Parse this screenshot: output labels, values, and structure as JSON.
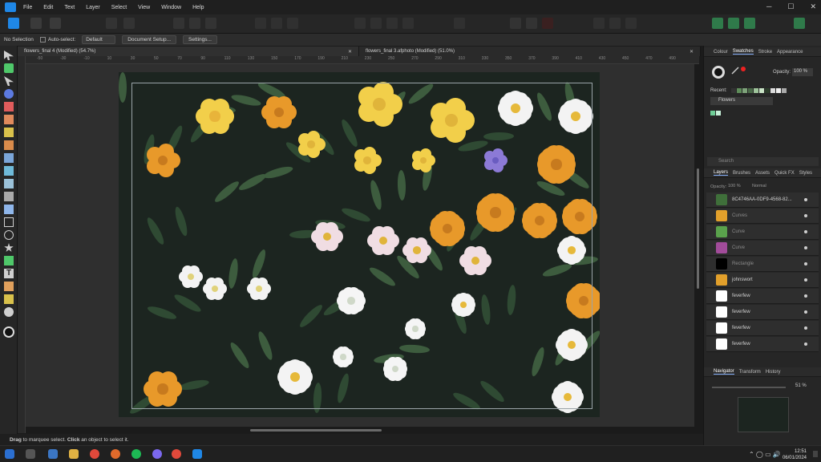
{
  "menu": [
    "File",
    "Edit",
    "Text",
    "Layer",
    "Select",
    "View",
    "Window",
    "Help"
  ],
  "context": {
    "selection": "No Selection",
    "autoselect_label": "Auto-select:",
    "autoselect_value": "Default",
    "document_setup": "Document Setup...",
    "settings": "Settings..."
  },
  "tabs": [
    {
      "label": "flowers_final 4 (Modified) (54.7%)"
    },
    {
      "label": "flowers_final 3.afphoto (Modified) (51.0%)"
    }
  ],
  "ruler_labels": [
    "-50",
    "-40",
    "-30",
    "-20",
    "-10",
    "0",
    "10",
    "20",
    "30",
    "40",
    "50",
    "60",
    "70",
    "80",
    "90",
    "100",
    "110",
    "120",
    "130",
    "140",
    "150",
    "160",
    "170",
    "180",
    "190",
    "200",
    "210",
    "220",
    "230",
    "240",
    "250",
    "260",
    "270",
    "280",
    "290",
    "300",
    "310",
    "320",
    "330",
    "340",
    "350",
    "360",
    "370",
    "380",
    "390",
    "400",
    "410",
    "420",
    "430",
    "440",
    "450",
    "460",
    "470",
    "480",
    "490",
    "500"
  ],
  "right_panel": {
    "top_tabs": [
      "Colour",
      "Swatches",
      "Stroke",
      "Appearance"
    ],
    "opacity_label": "Opacity:",
    "opacity_value": "100 %",
    "recent_label": "Recent:",
    "palette_name": "Flowers",
    "search_placeholder": "Search",
    "layer_tabs": [
      "Layers",
      "Brushes",
      "Assets",
      "Quick FX",
      "Styles"
    ],
    "layer_opacity_label": "Opacity:",
    "layer_opacity_value": "100 %",
    "blend_mode": "Normal",
    "layers": [
      {
        "name": "8C4746AA-0DF9-4568-82...",
        "color": "#3f6f3a",
        "dim": false
      },
      {
        "name": "Curves",
        "color": "#e2a02b",
        "dim": true
      },
      {
        "name": "Curve",
        "color": "#5aa24c",
        "dim": true
      },
      {
        "name": "Curve",
        "color": "#a24c9a",
        "dim": true
      },
      {
        "name": "Rectangle",
        "color": "#000000",
        "dim": true
      },
      {
        "name": "johnswort",
        "color": "#e2a02b",
        "dim": false
      },
      {
        "name": "feverfew",
        "color": "#ffffff",
        "dim": false
      },
      {
        "name": "feverfew",
        "color": "#ffffff",
        "dim": false
      },
      {
        "name": "feverfew",
        "color": "#ffffff",
        "dim": false
      },
      {
        "name": "feverfew",
        "color": "#ffffff",
        "dim": false
      }
    ],
    "nav_tabs": [
      "Navigator",
      "Transform",
      "History"
    ],
    "zoom_value": "51 %"
  },
  "status_text": {
    "bold1": "Drag",
    "t1": " to marquee select. ",
    "bold2": "Click",
    "t2": " an object to select it."
  },
  "clock": {
    "time": "12:51",
    "date": "06/01/2024"
  },
  "colors": {
    "accent": "#1f87e6",
    "canvas_bg": "#1c2520",
    "yellow": "#f2cf4a",
    "orange": "#e8992a",
    "purple": "#8c7ad6"
  }
}
